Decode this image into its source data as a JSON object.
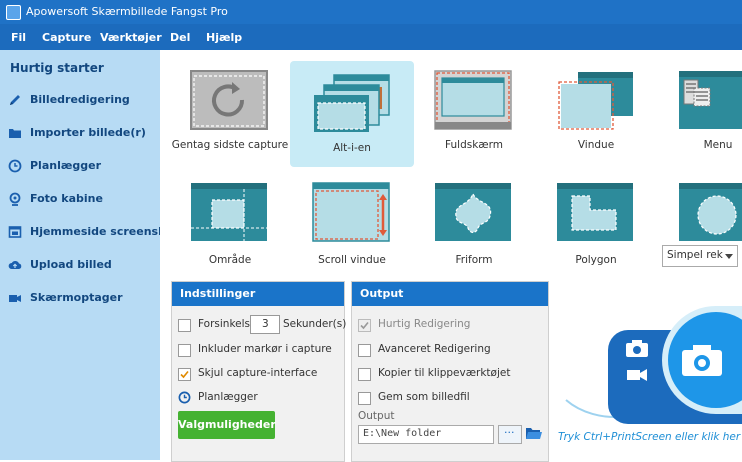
{
  "window": {
    "title": "Apowersoft Skærmbillede Fangst Pro"
  },
  "menu": [
    "Fil",
    "Capture",
    "Værktøjer",
    "Del",
    "Hjælp"
  ],
  "sidebar": {
    "heading": "Hurtig starter",
    "items": [
      {
        "label": "Billedredigering",
        "icon": "pencil-icon"
      },
      {
        "label": "Importer billede(r)",
        "icon": "folder-icon"
      },
      {
        "label": "Planlægger",
        "icon": "clock-icon"
      },
      {
        "label": "Foto kabine",
        "icon": "webcam-icon"
      },
      {
        "label": "Hjemmeside screenshot",
        "icon": "webpage-icon"
      },
      {
        "label": "Upload billed",
        "icon": "cloud-upload-icon"
      },
      {
        "label": "Skærmoptager",
        "icon": "video-camera-icon"
      }
    ]
  },
  "modes": [
    {
      "label": "Gentag sidste capture",
      "selected": false
    },
    {
      "label": "Alt-i-en",
      "selected": true
    },
    {
      "label": "Fuldskærm",
      "selected": false
    },
    {
      "label": "Vindue",
      "selected": false
    },
    {
      "label": "Menu",
      "selected": false
    },
    {
      "label": "Område",
      "selected": false
    },
    {
      "label": "Scroll vindue",
      "selected": false
    },
    {
      "label": "Friform",
      "selected": false
    },
    {
      "label": "Polygon",
      "selected": false
    },
    {
      "label": "",
      "selected": false
    }
  ],
  "shape_select": {
    "value": "Simpel rek"
  },
  "settings": {
    "title": "Indstillinger",
    "delay": {
      "label": "Forsinkelse",
      "value": "3",
      "unit": "Sekunder(s)",
      "checked": false
    },
    "include_cursor": {
      "label": "Inkluder markør i capture",
      "checked": false
    },
    "hide_interface": {
      "label": "Skjul capture-interface",
      "checked": true
    },
    "scheduler": {
      "label": "Planlægger"
    },
    "options_button": "Valgmuligheder"
  },
  "output": {
    "title": "Output",
    "quick_edit": {
      "label": "Hurtig Redigering",
      "checked": true,
      "disabled": true
    },
    "advanced_edit": {
      "label": "Avanceret Redigering",
      "checked": false
    },
    "copy_clipboard": {
      "label": "Kopier til klippeværktøjet",
      "checked": false
    },
    "save_file": {
      "label": "Gem som billedfil",
      "checked": false
    },
    "folder_label": "Output",
    "folder_path": "E:\\New folder",
    "browse_label": "···"
  },
  "capture_hint": "Tryk Ctrl+PrintScreen eller klik her",
  "colors": {
    "accent": "#1a74c9",
    "sidebar": "#b7dbf4",
    "green": "#45b232",
    "selected": "#c8ebf6",
    "teal": "#2d8b9b"
  }
}
